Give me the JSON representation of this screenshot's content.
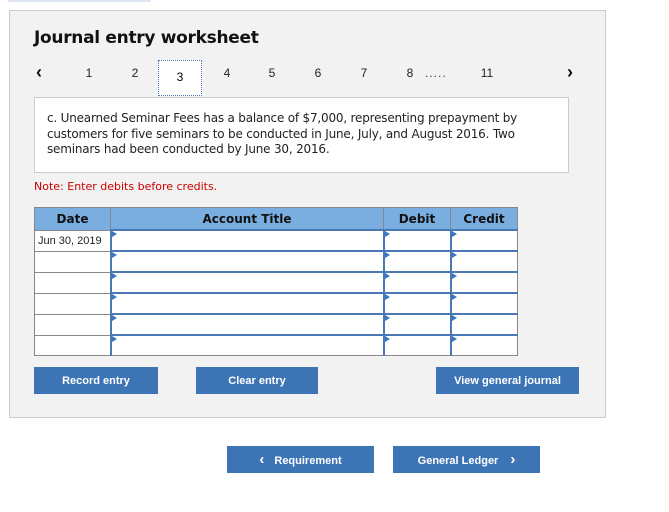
{
  "title": "Journal entry worksheet",
  "pagination": {
    "prev": "‹",
    "next": "›",
    "pages": [
      "1",
      "2",
      "3",
      "4",
      "5",
      "6",
      "7",
      "8",
      "11"
    ],
    "active": "3",
    "ellipsis": "....."
  },
  "question": "c. Unearned Seminar Fees has a balance of $7,000, representing prepayment by customers for five seminars to be conducted in June, July, and August 2016. Two seminars had been conducted by June 30, 2016.",
  "note": "Note: Enter debits before credits.",
  "table": {
    "headers": [
      "Date",
      "Account Title",
      "Debit",
      "Credit"
    ],
    "rows": [
      {
        "date": "Jun 30, 2019"
      },
      {
        "date": ""
      },
      {
        "date": ""
      },
      {
        "date": ""
      },
      {
        "date": ""
      },
      {
        "date": ""
      }
    ]
  },
  "buttons": {
    "record": "Record entry",
    "clear": "Clear entry",
    "view": "View general journal"
  },
  "nav": {
    "requirement": "Requirement",
    "general_ledger": "General Ledger",
    "prev_icon": "‹",
    "next_icon": "›"
  }
}
